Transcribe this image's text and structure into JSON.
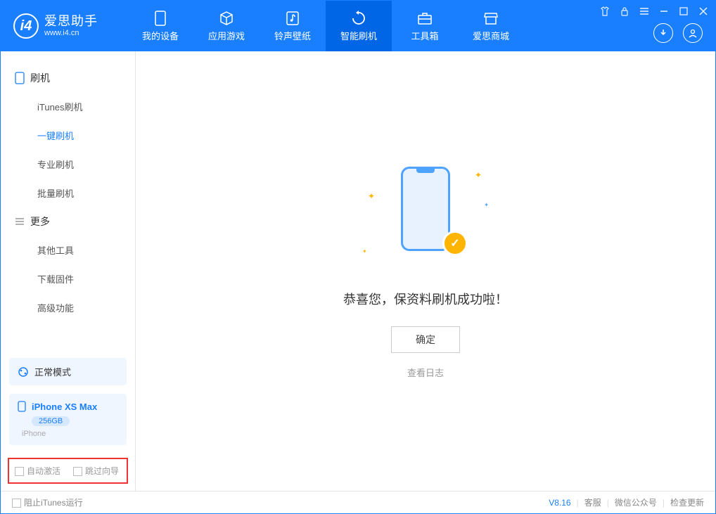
{
  "app": {
    "title": "爱思助手",
    "subtitle": "www.i4.cn"
  },
  "nav": {
    "tabs": [
      {
        "label": "我的设备"
      },
      {
        "label": "应用游戏"
      },
      {
        "label": "铃声壁纸"
      },
      {
        "label": "智能刷机"
      },
      {
        "label": "工具箱"
      },
      {
        "label": "爱思商城"
      }
    ]
  },
  "sidebar": {
    "section1_title": "刷机",
    "items1": [
      {
        "label": "iTunes刷机"
      },
      {
        "label": "一键刷机"
      },
      {
        "label": "专业刷机"
      },
      {
        "label": "批量刷机"
      }
    ],
    "section2_title": "更多",
    "items2": [
      {
        "label": "其他工具"
      },
      {
        "label": "下载固件"
      },
      {
        "label": "高级功能"
      }
    ],
    "mode_label": "正常模式",
    "device": {
      "name": "iPhone XS Max",
      "storage": "256GB",
      "type": "iPhone"
    },
    "opt_auto_activate": "自动激活",
    "opt_skip_guide": "跳过向导"
  },
  "main": {
    "success_text": "恭喜您，保资料刷机成功啦！",
    "confirm_label": "确定",
    "view_log_label": "查看日志"
  },
  "status": {
    "block_itunes": "阻止iTunes运行",
    "version": "V8.16",
    "links": [
      "客服",
      "微信公众号",
      "检查更新"
    ]
  }
}
